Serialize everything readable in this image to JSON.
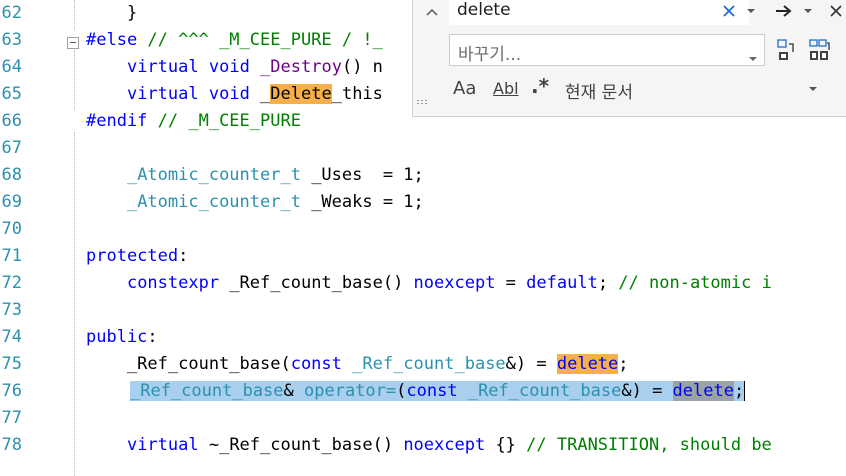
{
  "editor": {
    "colors": {
      "line_number": "#2b91af",
      "keyword": "#0000ff",
      "type": "#2b91af",
      "comment": "#008000",
      "macro": "#6f008a",
      "find_highlight": "#f5b04a",
      "selection": "#a8cfee"
    },
    "lines": [
      {
        "num": "62",
        "t1": "    }"
      },
      {
        "num": "63",
        "kw": "#else",
        "cm": " // ^^^ _M_CEE_PURE / !_"
      },
      {
        "num": "64",
        "t1": "    ",
        "kw1": "virtual",
        "t2": " ",
        "kw2": "void",
        "t3": " ",
        "mac": "_Destroy",
        "t4": "() n"
      },
      {
        "num": "65",
        "t1": "    ",
        "kw1": "virtual",
        "t2": " ",
        "kw2": "void",
        "t3": " _",
        "hl": "Delete",
        "t4": "_this"
      },
      {
        "num": "66",
        "kw": "#endif",
        "cm": " // _M_CEE_PURE"
      },
      {
        "num": "67"
      },
      {
        "num": "68",
        "t1": "    ",
        "ty": "_Atomic_counter_t",
        "t2": " _Uses  = 1;"
      },
      {
        "num": "69",
        "t1": "    ",
        "ty": "_Atomic_counter_t",
        "t2": " _Weaks = 1;"
      },
      {
        "num": "70"
      },
      {
        "num": "71",
        "kw": "protected",
        "t1": ":"
      },
      {
        "num": "72",
        "t1": "    ",
        "kw1": "constexpr",
        "t2": " _Ref_count_base() ",
        "kw2": "noexcept",
        "t3": " = ",
        "kw3": "default",
        "t4": "; ",
        "cm": "// non-atomic i"
      },
      {
        "num": "73"
      },
      {
        "num": "74",
        "kw": "public",
        "t1": ":"
      },
      {
        "num": "75",
        "t1": "    _Ref_count_base(",
        "kw1": "const",
        "t2": " ",
        "ty": "_Ref_count_base",
        "t3": "&) = ",
        "hl": "delete",
        "t4": ";"
      },
      {
        "num": "76",
        "ty1": "_Ref_count_base",
        "t1": "& ",
        "op": "operator=",
        "t2": "(",
        "kw1": "const",
        "t3": " ",
        "ty2": "_Ref_count_base",
        "t4": "&) = ",
        "hl": "delete",
        "t5": ";"
      },
      {
        "num": "77"
      },
      {
        "num": "78",
        "t1": "    ",
        "kw1": "virtual",
        "t2": " ~_Ref_count_base() ",
        "kw2": "noexcept",
        "t3": " {} ",
        "cm": "// TRANSITION, should be"
      }
    ]
  },
  "find": {
    "search_value": "delete",
    "replace_placeholder": "바꾸기...",
    "match_case_label": "Aa",
    "whole_word_label": "Abl",
    "regex_label": ".*",
    "scope_label": "현재 문서"
  }
}
